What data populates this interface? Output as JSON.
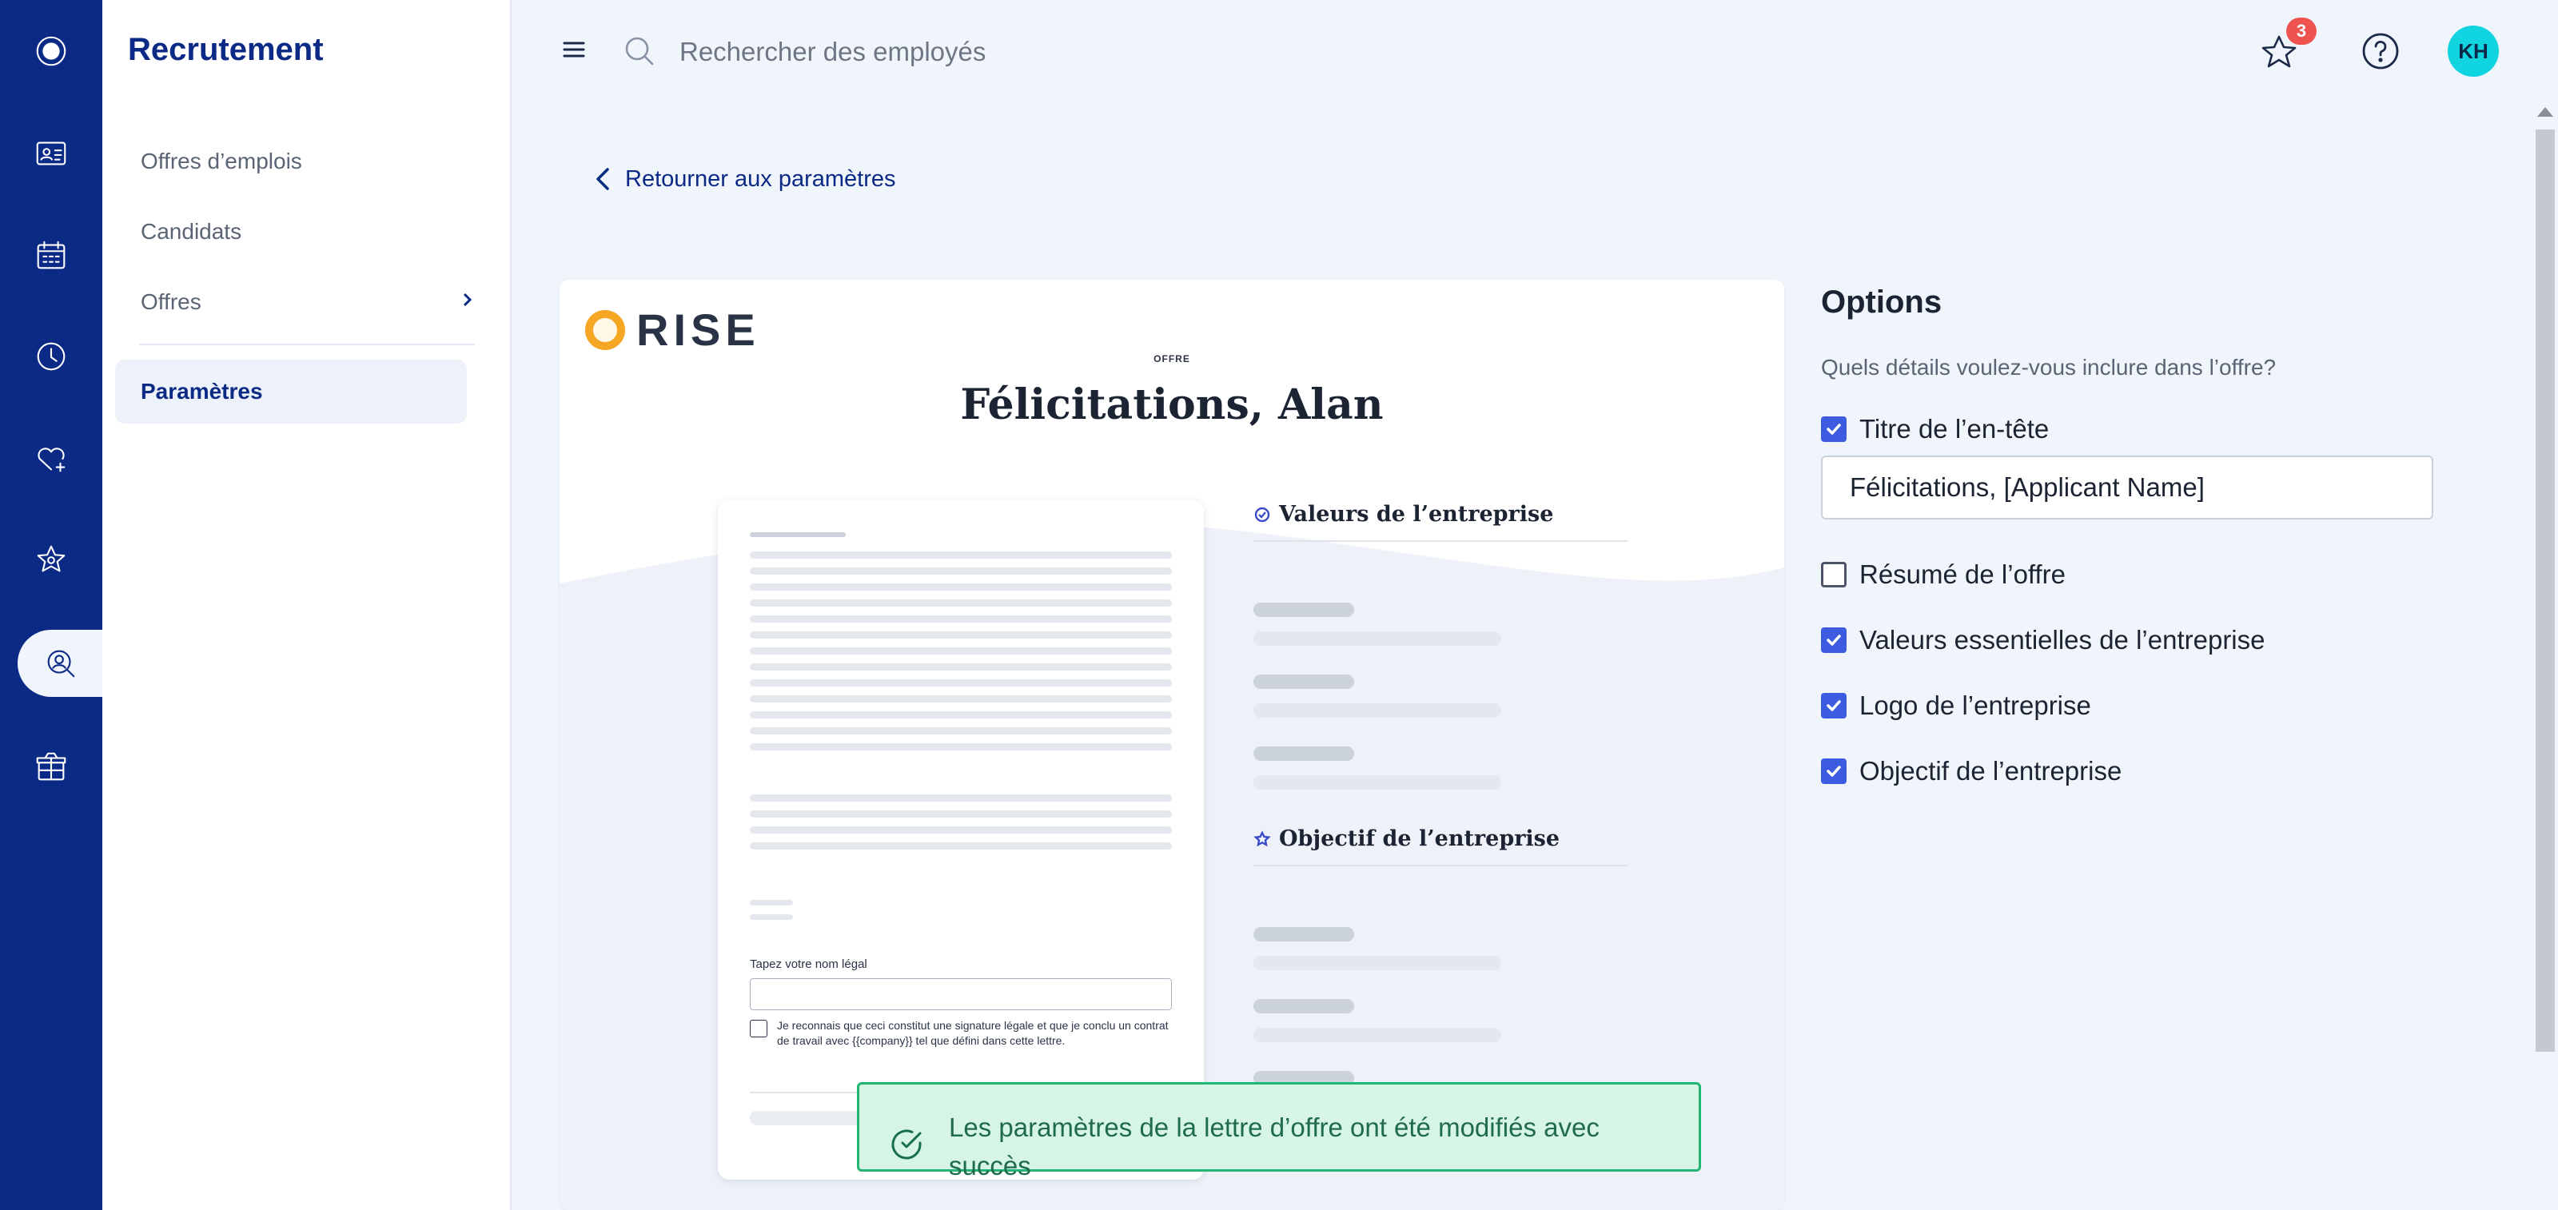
{
  "rail": {
    "items": [
      {
        "name": "home-logo-icon"
      },
      {
        "name": "id-card-icon"
      },
      {
        "name": "calendar-icon"
      },
      {
        "name": "clock-icon"
      },
      {
        "name": "heart-plus-icon"
      },
      {
        "name": "star-badge-icon"
      },
      {
        "name": "recruitment-search-icon",
        "active": true
      },
      {
        "name": "gift-box-icon"
      }
    ]
  },
  "subnav": {
    "title": "Recrutement",
    "items": [
      {
        "label": "Offres d’emplois"
      },
      {
        "label": "Candidats"
      },
      {
        "label": "Offres"
      }
    ],
    "active_label": "Paramètres"
  },
  "topbar": {
    "search_placeholder": "Rechercher des employés",
    "notification_count": "3",
    "avatar_initials": "KH"
  },
  "back_link": "Retourner aux paramètres",
  "preview": {
    "logo_text": "RISE",
    "eyebrow": "OFFRE",
    "title": "Félicitations, Alan",
    "signature_label": "Tapez votre nom légal",
    "signature_ack": "Je reconnais que ceci constitut une signature légale et que je conclu un contrat de travail avec {{company}} tel que défini dans cette lettre.",
    "section_values": "Valeurs de l’entreprise",
    "section_objective": "Objectif de l’entreprise"
  },
  "options": {
    "title": "Options",
    "question": "Quels détails voulez-vous inclure dans l’offre?",
    "header_title": {
      "label": "Titre de l’en-tête",
      "checked": true,
      "value": "Félicitations, [Applicant Name]"
    },
    "summary": {
      "label": "Résumé de l’offre",
      "checked": false
    },
    "values": {
      "label": "Valeurs essentielles de l’entreprise",
      "checked": true
    },
    "logo": {
      "label": "Logo de l’entreprise",
      "checked": true
    },
    "objective": {
      "label": "Objectif de l’entreprise",
      "checked": true
    }
  },
  "toast": {
    "message": "Les paramètres de la lettre d’offre ont été modifiés avec succès"
  },
  "colors": {
    "rail": "#0b2a86",
    "accent": "#3d5be0",
    "success_bg": "#d6f5e6",
    "success_border": "#22b573",
    "badge": "#ef5350",
    "avatar": "#10d4e0"
  }
}
